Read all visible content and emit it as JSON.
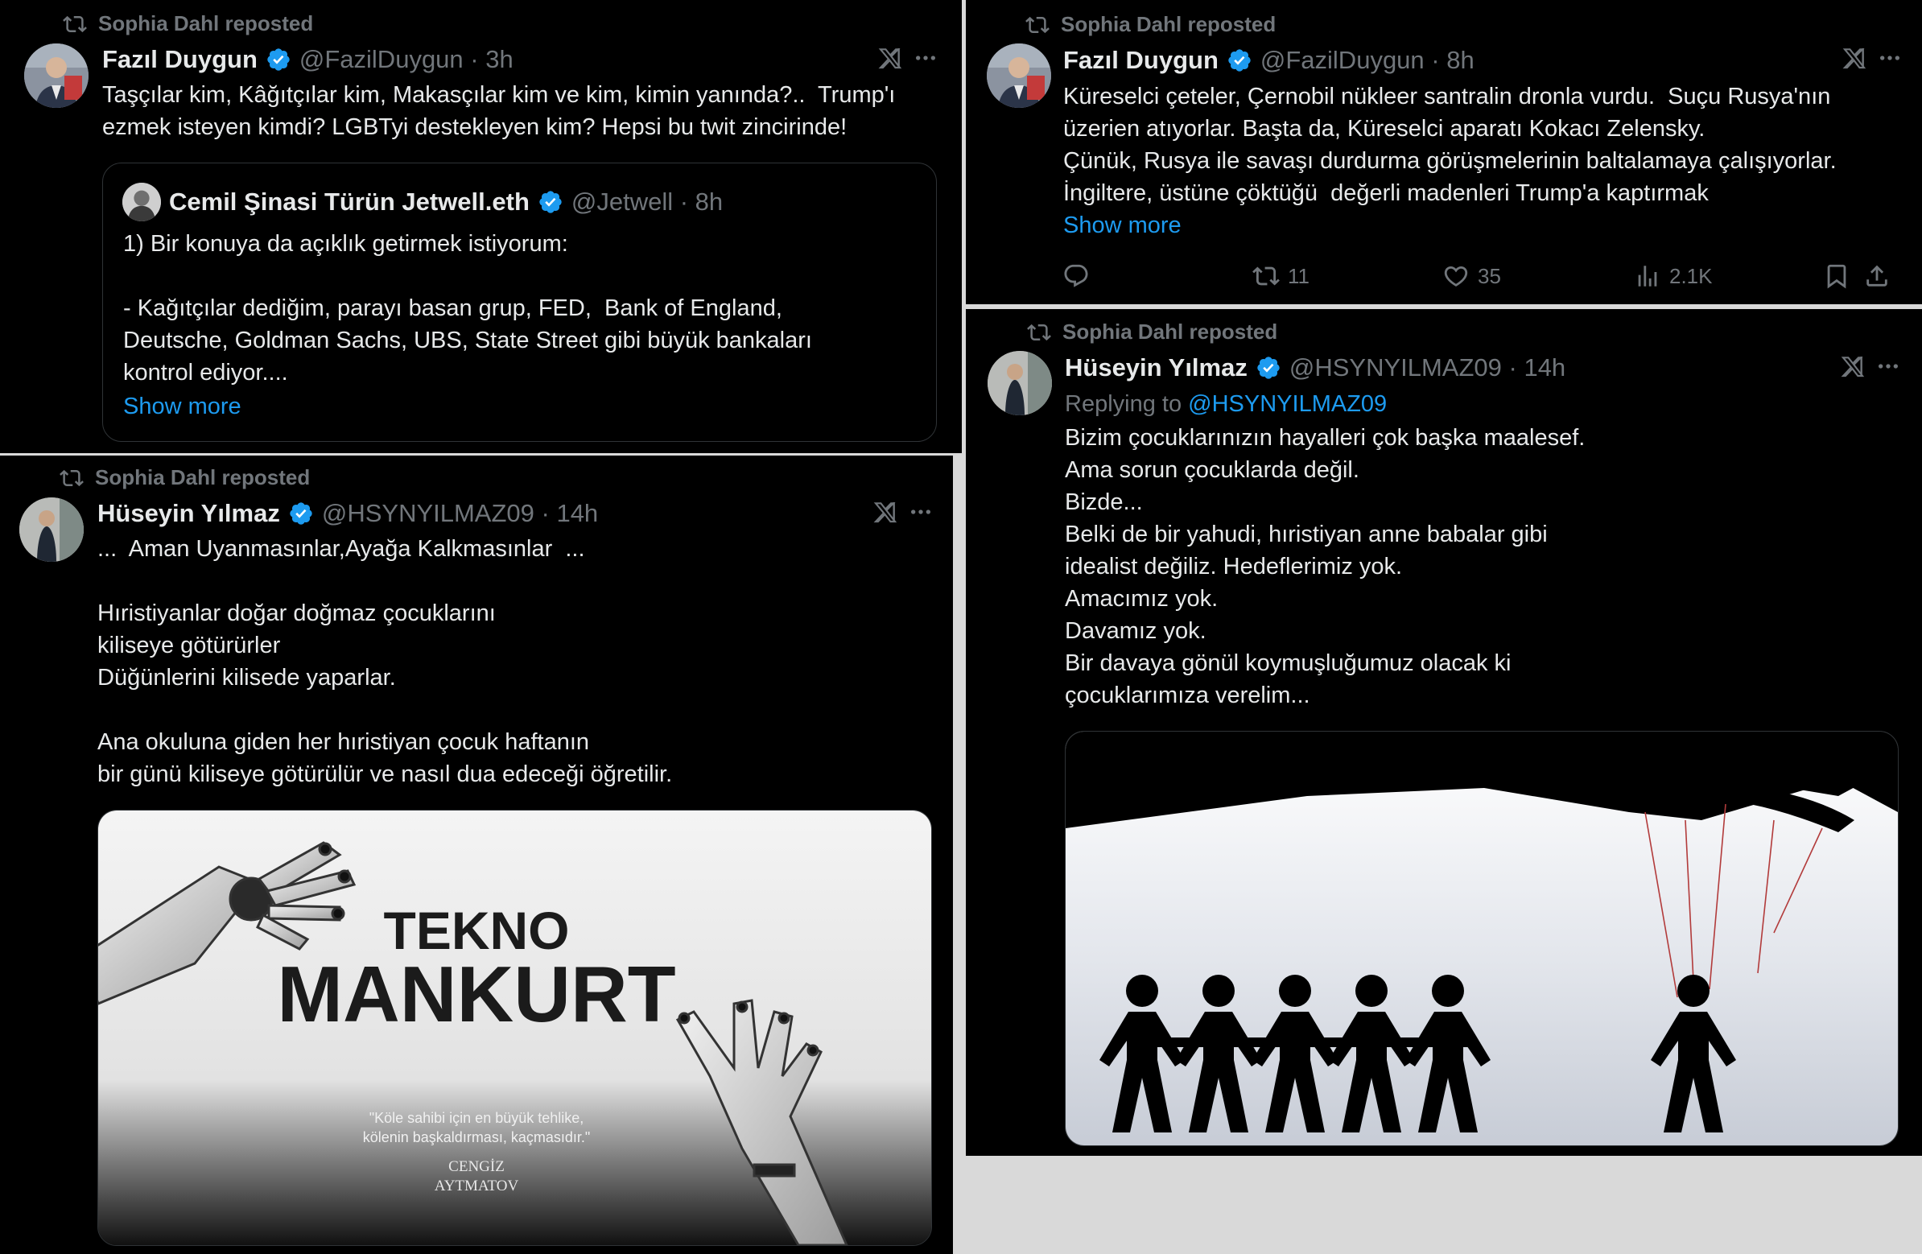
{
  "colors": {
    "background": "#000000",
    "text": "#e7e9ea",
    "muted": "#71767b",
    "link": "#1d9bf0",
    "verified": "#1d9bf0"
  },
  "icons": [
    "repost-icon",
    "verified-badge-icon",
    "grok-icon",
    "more-icon",
    "reply-icon",
    "retweet-icon",
    "like-icon",
    "views-icon",
    "bookmark-icon",
    "share-icon"
  ],
  "post1": {
    "repost_label": "Sophia Dahl reposted",
    "name": "Fazıl Duygun",
    "handle_time": "@FazilDuygun · 3h",
    "text": "Taşçılar kim, Kâğıtçılar kim, Makasçılar kim ve kim, kimin yanında?..  Trump'ı\nezmek isteyen kimdi? LGBTyi destekleyen kim? Hepsi bu twit zincirinde!",
    "quote": {
      "name": "Cemil Şinasi Türün Jetwell.eth",
      "handle_time": "@Jetwell · 8h",
      "text": "1) Bir konuya da açıklık getirmek istiyorum:\n\n- Kağıtçılar dediğim, parayı basan grup, FED,  Bank of England,\nDeutsche, Goldman Sachs, UBS, State Street gibi büyük bankaları\nkontrol ediyor....",
      "show_more": "Show more"
    }
  },
  "post2": {
    "repost_label": "Sophia Dahl reposted",
    "name": "Fazıl Duygun",
    "handle_time": "@FazilDuygun · 8h",
    "text": "Küreselci çeteler, Çernobil nükleer santralin dronla vurdu.  Suçu Rusya'nın\nüzerien atıyorlar. Başta da, Küreselci aparatı Kokacı Zelensky.\nÇünük, Rusya ile savaşı durdurma görüşmelerinin baltalamaya çalışıyorlar.\nİngiltere, üstüne çöktüğü  değerli madenleri Trump'a kaptırmak",
    "show_more": "Show more",
    "retweets": "11",
    "likes": "35",
    "views": "2.1K"
  },
  "post3": {
    "repost_label": "Sophia Dahl reposted",
    "name": "Hüseyin Yılmaz",
    "handle_time": "@HSYNYILMAZ09 · 14h",
    "text": "...  Aman Uyanmasınlar,Ayağa Kalkmasınlar  ...\n\nHıristiyanlar doğar doğmaz çocuklarını\nkiliseye götürürler\nDüğünlerini kilisede yaparlar.\n\nAna okuluna giden her hıristiyan çocuk haftanın\nbir günü kiliseye götürülür ve nasıl dua edeceği öğretilir.",
    "image": {
      "title_top": "TEKNO",
      "title_main": "MANKURT",
      "quote_line1": "\"Köle sahibi için en büyük tehlike,",
      "quote_line2": "kölenin başkaldırması, kaçmasıdır.\"",
      "author_line1": "CENGİZ",
      "author_line2": "AYTMATOV"
    }
  },
  "post4": {
    "repost_label": "Sophia Dahl reposted",
    "name": "Hüseyin Yılmaz",
    "handle_time": "@HSYNYILMAZ09 · 14h",
    "replying_prefix": "Replying to",
    "replying_handle": "@HSYNYILMAZ09",
    "text": "Bizim çocuklarınızın hayalleri çok başka maalesef.\nAma sorun çocuklarda değil.\nBizde...\nBelki de bir yahudi, hıristiyan anne babalar gibi\nidealist değiliz. Hedeflerimiz yok.\nAmacımız yok.\nDavamız yok.\nBir davaya gönül koymuşluğumuz olacak ki\nçocuklarımıza verelim..."
  }
}
